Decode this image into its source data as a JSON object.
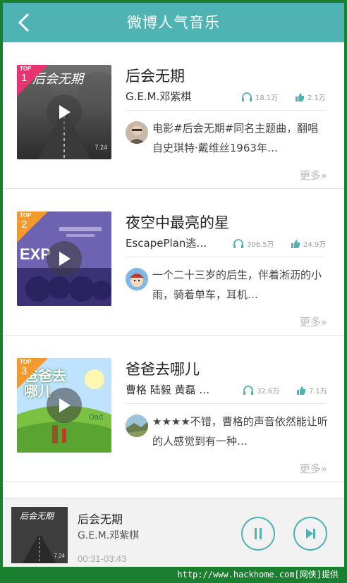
{
  "header": {
    "title": "微博人气音乐",
    "back_icon": "chevron-left-icon"
  },
  "colors": {
    "header_bg": "#4fb3b4",
    "accent": "#4fb3b4",
    "rank1_badge": "#e8336f",
    "rank_other_badge": "#f29a2e"
  },
  "songs": [
    {
      "rank_top": "TOP",
      "rank": "1",
      "title": "后会无期",
      "artist": "G.E.M.邓紫棋",
      "listens": "18.1万",
      "likes": "2.1万",
      "comment": "电影#后会无期#同名主题曲，翻唱自史琪特·戴维丝1963年…",
      "more": "更多»",
      "cover_text": "后会无期",
      "cover_date": "7.24"
    },
    {
      "rank_top": "TOP",
      "rank": "2",
      "title": "夜空中最亮的星",
      "artist": "EscapePlan逃…",
      "listens": "306.5万",
      "likes": "24.9万",
      "comment": "一个二十三岁的后生，伴着淅沥的小雨，骑着单车，耳机…",
      "more": "更多»",
      "cover_text": "EXP"
    },
    {
      "rank_top": "TOP",
      "rank": "3",
      "title": "爸爸去哪儿",
      "artist": "曹格 陆毅 黄磊 …",
      "listens": "32.6万",
      "likes": "7.1万",
      "comment": "★★★★不错，曹格的声音依然能让听的人感觉到有一种…",
      "more": "更多»",
      "cover_text": "爸爸去哪儿",
      "cover_sub": "Dad"
    }
  ],
  "player": {
    "title": "后会无期",
    "artist": "G.E.M.邓紫棋",
    "time": "00:31-03:43",
    "cover_text": "后会无期",
    "cover_date": "7.24",
    "pause_icon": "pause-icon",
    "next_icon": "next-track-icon"
  },
  "watermark": "http://www.hackhome.com[网侠]提供"
}
